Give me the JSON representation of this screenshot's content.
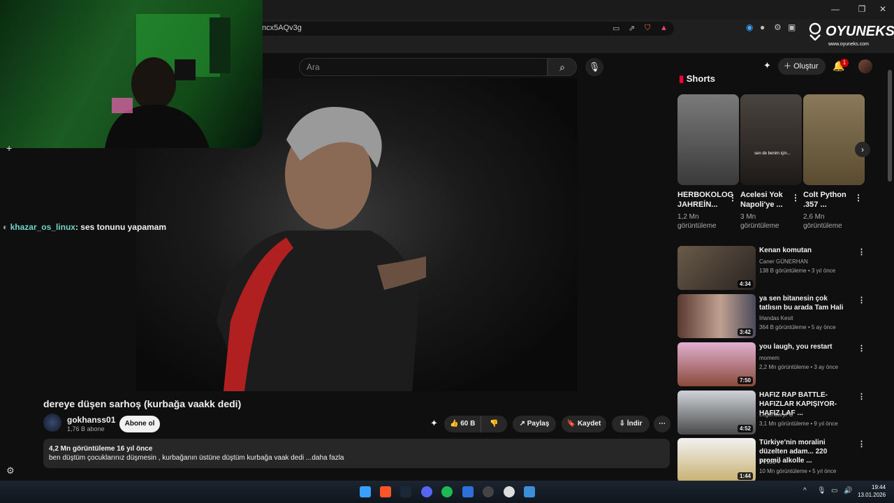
{
  "browser": {
    "url": "ncx5AQv3g",
    "minimize": "—",
    "maximize": "❐",
    "close": "✕"
  },
  "youtube": {
    "search_placeholder": "Ara",
    "create_label": "Oluştur",
    "notification_count": "1"
  },
  "logo": {
    "text": "OYUNEKS",
    "sub": "www.oyuneks.com"
  },
  "chat": {
    "user": "khazar_os_linux",
    "message": ": ses tonunu yapamam"
  },
  "video": {
    "title": "dereye düşen sarhoş (kurbağa vaakk dedi)",
    "channel": "gokhanss01",
    "subscribers": "1,76 B abone",
    "subscribe_label": "Abone ol",
    "likes": "60 B",
    "share_label": "Paylaş",
    "save_label": "Kaydet",
    "download_label": "İndir",
    "views_date": "4,2 Mn görüntüleme  16 yıl önce",
    "description": "ben düştüm çocuklarınız düşmesin , kurbağanın üstüne düştüm kurbağa vaak dedi ...daha fazla"
  },
  "shorts": {
    "heading": "Shorts",
    "items": [
      {
        "title": "HERBOKOLOG JAHREİN...",
        "views": "1,2 Mn görüntüleme"
      },
      {
        "title": "Acelesi Yok Napoli'ye ...",
        "views": "3 Mn görüntüleme",
        "caption": "sen de benim için..."
      },
      {
        "title": "Colt Python .357 ...",
        "views": "2,6 Mn görüntüleme"
      }
    ]
  },
  "recommendations": [
    {
      "title": "Kenan komutan",
      "channel": "Caner GÜNERHAN",
      "meta": "138 B görüntüleme • 3 yıl önce",
      "duration": "4:34"
    },
    {
      "title": "ya sen bitanesin çok tatlısın bu arada Tam Hali",
      "channel": "İrlandas Kesit",
      "meta": "364 B görüntüleme • 5 ay önce",
      "duration": "3:42"
    },
    {
      "title": "you laugh, you restart",
      "channel": "momem",
      "meta": "2,2 Mn görüntüleme • 3 ay önce",
      "duration": "7:50"
    },
    {
      "title": "HAFIZ RAP BATTLE-HAFIZLAR KAPIŞIYOR-HAFIZ LAF ...",
      "channel": "LegendaryFC",
      "meta": "3,1 Mn görüntüleme • 9 yıl önce",
      "duration": "4:52"
    },
    {
      "title": "Türkiye'nin moralini düzelten adam... 220 promil alkolle ...",
      "channel": "TV100",
      "meta": "10 Mn görüntüleme • 5 yıl önce",
      "duration": "1:44"
    }
  ],
  "taskbar": {
    "time": "19:44",
    "date": "13.01.2026"
  },
  "colors": {
    "accent": "#cc0000",
    "chat_user": "#6fd4c6",
    "background": "#0f0f0f"
  }
}
